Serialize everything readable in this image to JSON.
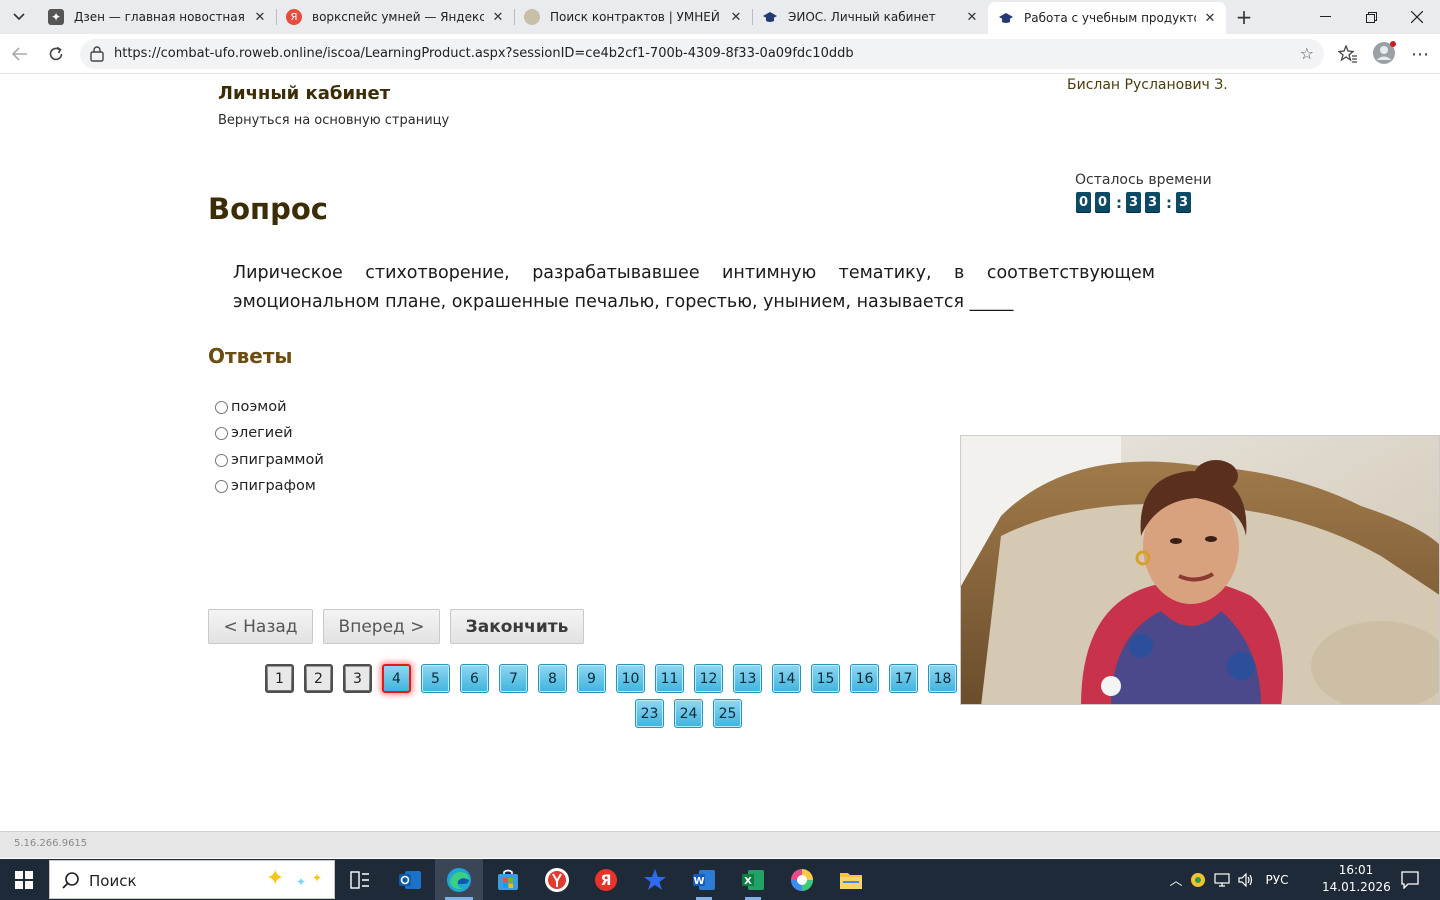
{
  "browser": {
    "tabs": [
      {
        "title": "Дзен — главная новостная инф",
        "favicon_color": "#555555"
      },
      {
        "title": "воркспейс умней — Яндекс: на",
        "favicon_color": "#e74c3c"
      },
      {
        "title": "Поиск контрактов | УМНЕЙ Wo",
        "favicon_color": "#9b8a6a"
      },
      {
        "title": "ЭИОС. Личный кабинет",
        "favicon_color": "#233a73"
      },
      {
        "title": "Работа с учебным продуктом",
        "favicon_color": "#233a73",
        "active": true
      }
    ],
    "url": "https://combat-ufo.roweb.online/iscoa/LearningProduct.aspx?sessionID=ce4b2cf1-700b-4309-8f33-0a09fdc10ddb"
  },
  "header": {
    "title": "Личный кабинет",
    "back_link": "Вернуться на основную страницу",
    "user": "Бислан Русланович З."
  },
  "timer": {
    "label": "Осталось времени",
    "digits": [
      "0",
      "0",
      "3",
      "3",
      "3"
    ]
  },
  "question": {
    "heading": "Вопрос",
    "text": "Лирическое стихотворение, разрабатывавшее интимную тематику, в соответствующем эмоциональном плане, окрашенные печалью, горестью, унынием, называется _____"
  },
  "answers": {
    "heading": "Ответы",
    "options": [
      "поэмой",
      "элегией",
      "эпиграммой",
      "эпиграфом"
    ]
  },
  "buttons": {
    "back": "< Назад",
    "next": "Вперед >",
    "finish": "Закончить"
  },
  "pagination": {
    "numbers": [
      "1",
      "2",
      "3",
      "4",
      "5",
      "6",
      "7",
      "8",
      "9",
      "10",
      "11",
      "12",
      "13",
      "14",
      "15",
      "16",
      "17",
      "18",
      "23",
      "24",
      "25"
    ],
    "current": "4",
    "completed": [
      "1",
      "2",
      "3"
    ]
  },
  "footer": {
    "version": "5.16.266.9615"
  },
  "taskbar": {
    "search_placeholder": "Поиск",
    "language": "РУС",
    "time": "16:01",
    "date": "14.01.2026"
  }
}
